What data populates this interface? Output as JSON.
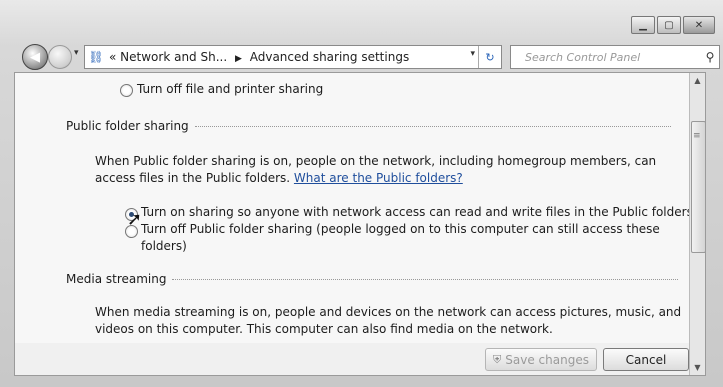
{
  "window": {
    "controls": [
      "minimize-icon",
      "maximize-icon",
      "close-icon"
    ]
  },
  "navbar": {
    "breadcrumb_prefix": "«",
    "breadcrumb_parent": "Network and Sh...",
    "breadcrumb_sep": "▶",
    "breadcrumb_current": "Advanced sharing settings",
    "search_placeholder": "Search Control Panel"
  },
  "content": {
    "prev_option": "Turn off file and printer sharing",
    "public_folder": {
      "heading": "Public folder sharing",
      "description_line1": "When Public folder sharing is on, people on the network, including homegroup members, can",
      "description_line2": "access files in the Public folders.",
      "link": "What are the Public folders?",
      "option_on": "Turn on sharing so anyone with network access can read and write files in the Public folders",
      "option_off_line1": "Turn off Public folder sharing (people logged on to this computer can still access these",
      "option_off_line2": "folders)"
    },
    "media": {
      "heading": "Media streaming",
      "description_line1": "When media streaming is on, people and devices on the network can access pictures, music, and",
      "description_line2": "videos on this computer. This computer can also find media on the network."
    }
  },
  "buttons": {
    "save": "Save changes",
    "cancel": "Cancel"
  },
  "colors": {
    "link": "#1f4e9c",
    "accent": "#2a64b8"
  }
}
